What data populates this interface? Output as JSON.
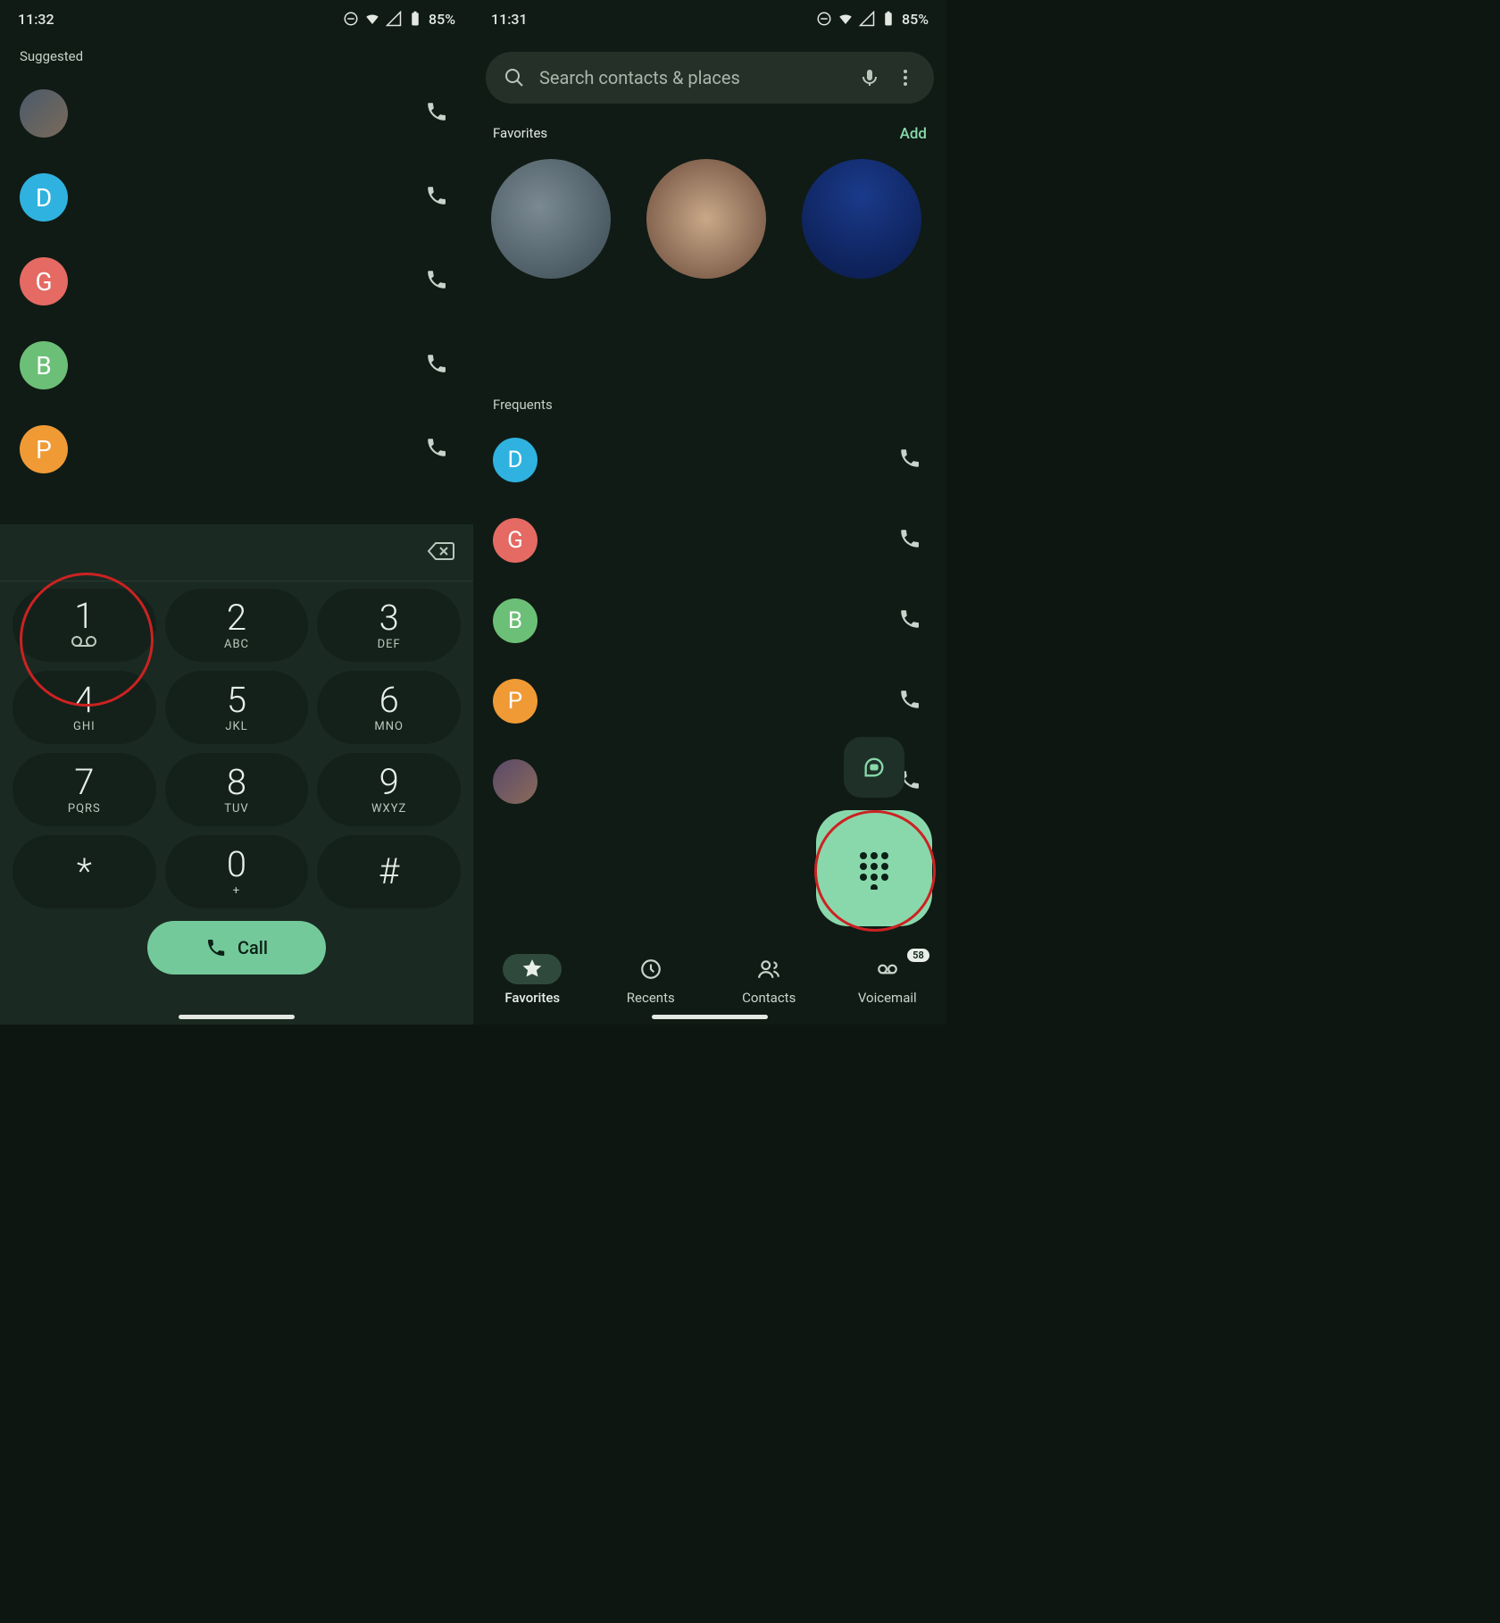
{
  "left": {
    "status": {
      "time": "11:32",
      "battery": "85%"
    },
    "suggestedLabel": "Suggested",
    "suggested": [
      {
        "type": "img"
      },
      {
        "type": "letter",
        "letter": "D",
        "color": "#2fb2df"
      },
      {
        "type": "letter",
        "letter": "G",
        "color": "#e46a63"
      },
      {
        "type": "letter",
        "letter": "B",
        "color": "#6cbf77"
      },
      {
        "type": "letter",
        "letter": "P",
        "color": "#f09a36"
      }
    ],
    "keys": [
      {
        "d": "1",
        "sub": "vm"
      },
      {
        "d": "2",
        "sub": "ABC"
      },
      {
        "d": "3",
        "sub": "DEF"
      },
      {
        "d": "4",
        "sub": "GHI"
      },
      {
        "d": "5",
        "sub": "JKL"
      },
      {
        "d": "6",
        "sub": "MNO"
      },
      {
        "d": "7",
        "sub": "PQRS"
      },
      {
        "d": "8",
        "sub": "TUV"
      },
      {
        "d": "9",
        "sub": "WXYZ"
      },
      {
        "d": "*",
        "sub": ""
      },
      {
        "d": "0",
        "sub": "+"
      },
      {
        "d": "#",
        "sub": ""
      }
    ],
    "callLabel": "Call"
  },
  "right": {
    "status": {
      "time": "11:31",
      "battery": "85%"
    },
    "searchPlaceholder": "Search contacts & places",
    "favoritesLabel": "Favorites",
    "addLabel": "Add",
    "frequentsLabel": "Frequents",
    "frequents": [
      {
        "type": "letter",
        "letter": "D",
        "color": "#2fb2df"
      },
      {
        "type": "letter",
        "letter": "G",
        "color": "#e46a63"
      },
      {
        "type": "letter",
        "letter": "B",
        "color": "#6cbf77"
      },
      {
        "type": "letter",
        "letter": "P",
        "color": "#f09a36"
      },
      {
        "type": "img"
      }
    ],
    "nav": {
      "favorites": "Favorites",
      "recents": "Recents",
      "contacts": "Contacts",
      "voicemail": "Voicemail",
      "vmCount": "58"
    }
  }
}
